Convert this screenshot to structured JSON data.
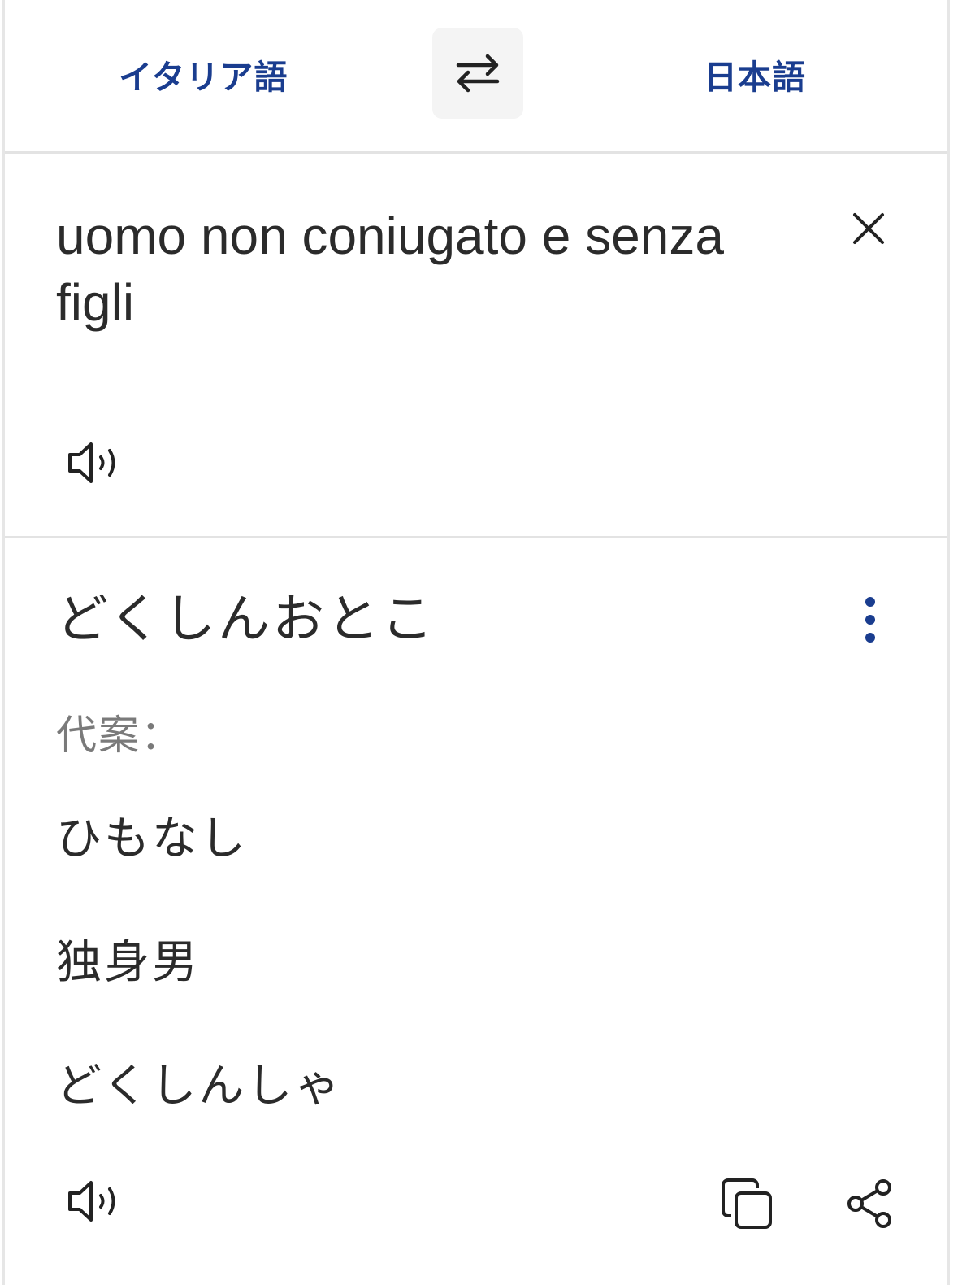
{
  "languages": {
    "source": "イタリア語",
    "target": "日本語",
    "swap_icon": "swap-arrows-icon"
  },
  "source": {
    "text": "uomo non coniugato e senza figli",
    "clear_icon": "close-icon",
    "speak_icon": "speaker-icon"
  },
  "result": {
    "translation": "どくしんおとこ",
    "more_icon": "more-vert-icon",
    "alternatives_label": "代案：",
    "alternatives": [
      "ひもなし",
      "独身男",
      "どくしんしゃ"
    ],
    "speak_icon": "speaker-icon",
    "copy_icon": "copy-icon",
    "share_icon": "share-icon"
  },
  "colors": {
    "accent": "#1a3d8f",
    "text": "#2b2b2b",
    "muted": "#7a7a7a",
    "divider": "#e3e3e3"
  }
}
